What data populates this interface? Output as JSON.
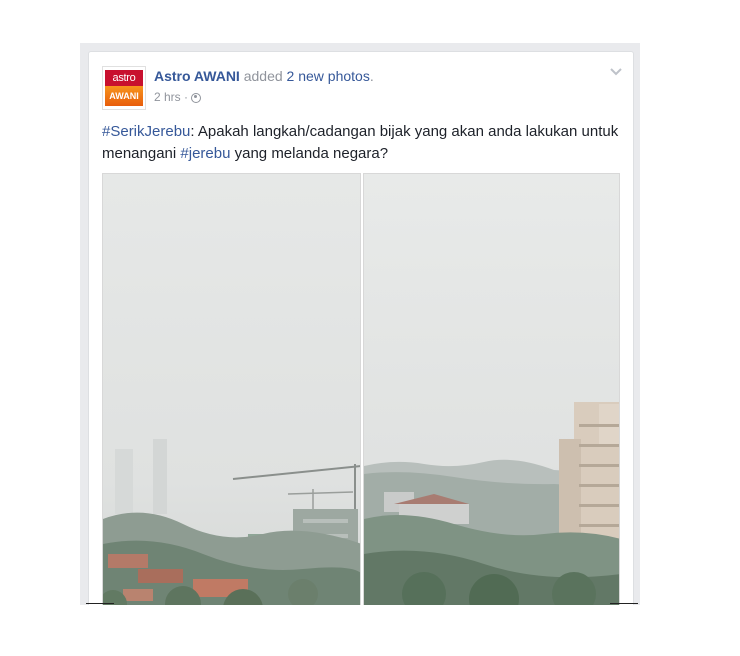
{
  "post": {
    "page_name": "Astro AWANI",
    "action_prefix": "added",
    "action_link": "2 new photos",
    "action_suffix": ".",
    "time": "2 hrs",
    "separator": "·",
    "privacy_icon": "globe-icon",
    "options_icon": "chevron-down-icon",
    "avatar": {
      "logo_top": "astro",
      "logo_bottom": "AWANI"
    },
    "text": {
      "hashtag_1": "#SerikJerebu",
      "part_1": ": Apakah langkah/cadangan bijak yang akan anda lakukan untuk menangani ",
      "hashtag_2": "#jerebu",
      "part_2": " yang melanda negara?"
    },
    "photos": [
      {
        "scene": "hazy city skyline with cranes and rooftops"
      },
      {
        "scene": "hazy view of apartment towers and trees"
      }
    ]
  },
  "colors": {
    "link": "#365899",
    "text": "#1d2129",
    "meta": "#90949c",
    "frame": "#e9eaed",
    "haze": "#e3e5e4"
  }
}
